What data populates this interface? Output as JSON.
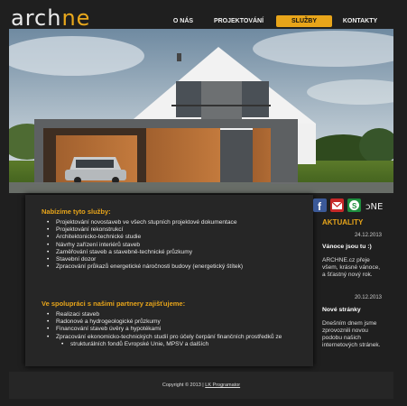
{
  "logo": {
    "text_a": "ARCH",
    "text_b": "NE"
  },
  "nav": {
    "items": [
      "O NÁS",
      "PROJEKTOVÁNÍ",
      "SLUŽBY",
      "KONTAKTY"
    ],
    "active": 2
  },
  "section1": {
    "title": "Nabízíme tyto služby:",
    "items": [
      "Projektování novostaveb ve všech stupních projektové dokumentace",
      "Projektování rekonstrukcí",
      "Architektonicko-technické studie",
      "Návrhy zařízení interiérů staveb",
      "Zaměřování staveb a stavebně-technické průzkumy",
      "Stavební dozor",
      "Zpracování průkazů energetické náročnosti budovy (energetický štítek)"
    ]
  },
  "section2": {
    "title": "Ve spolupráci s našimi partnery zajišťujeme:",
    "items": [
      "Realizaci staveb",
      "Radonové a hydrogeologické průzkumy",
      "Financování staveb úvěry a hypotékami",
      "Zpracování ekonomicko-technických studií pro účely čerpání finančních prostředků ze",
      "strukturálních fondů Evropské Unie, MPSV a dalších"
    ]
  },
  "social": [
    "facebook-icon",
    "email-icon",
    "skype-icon",
    "archne-icon"
  ],
  "sidebar": {
    "title": "AKTUALITY",
    "news": [
      {
        "date": "24.12.2013",
        "title": "Vánoce jsou tu :)",
        "text": [
          "ARCHNE.cz přeje",
          "všem, krásné vánoce,",
          "a šťastný nový rok."
        ]
      },
      {
        "date": "20.12.2013",
        "title": "Nové stránky",
        "text": [
          "Dnešním dnem jsme",
          "zprovoznili novou",
          "podobu našich",
          "internetových stránek."
        ]
      }
    ]
  },
  "footer": {
    "text": "Copyright © 2013 |",
    "link": "LK Programator"
  },
  "colors": {
    "accent": "#e8a51a",
    "background": "#1f1f1f",
    "panel": "#262626"
  }
}
